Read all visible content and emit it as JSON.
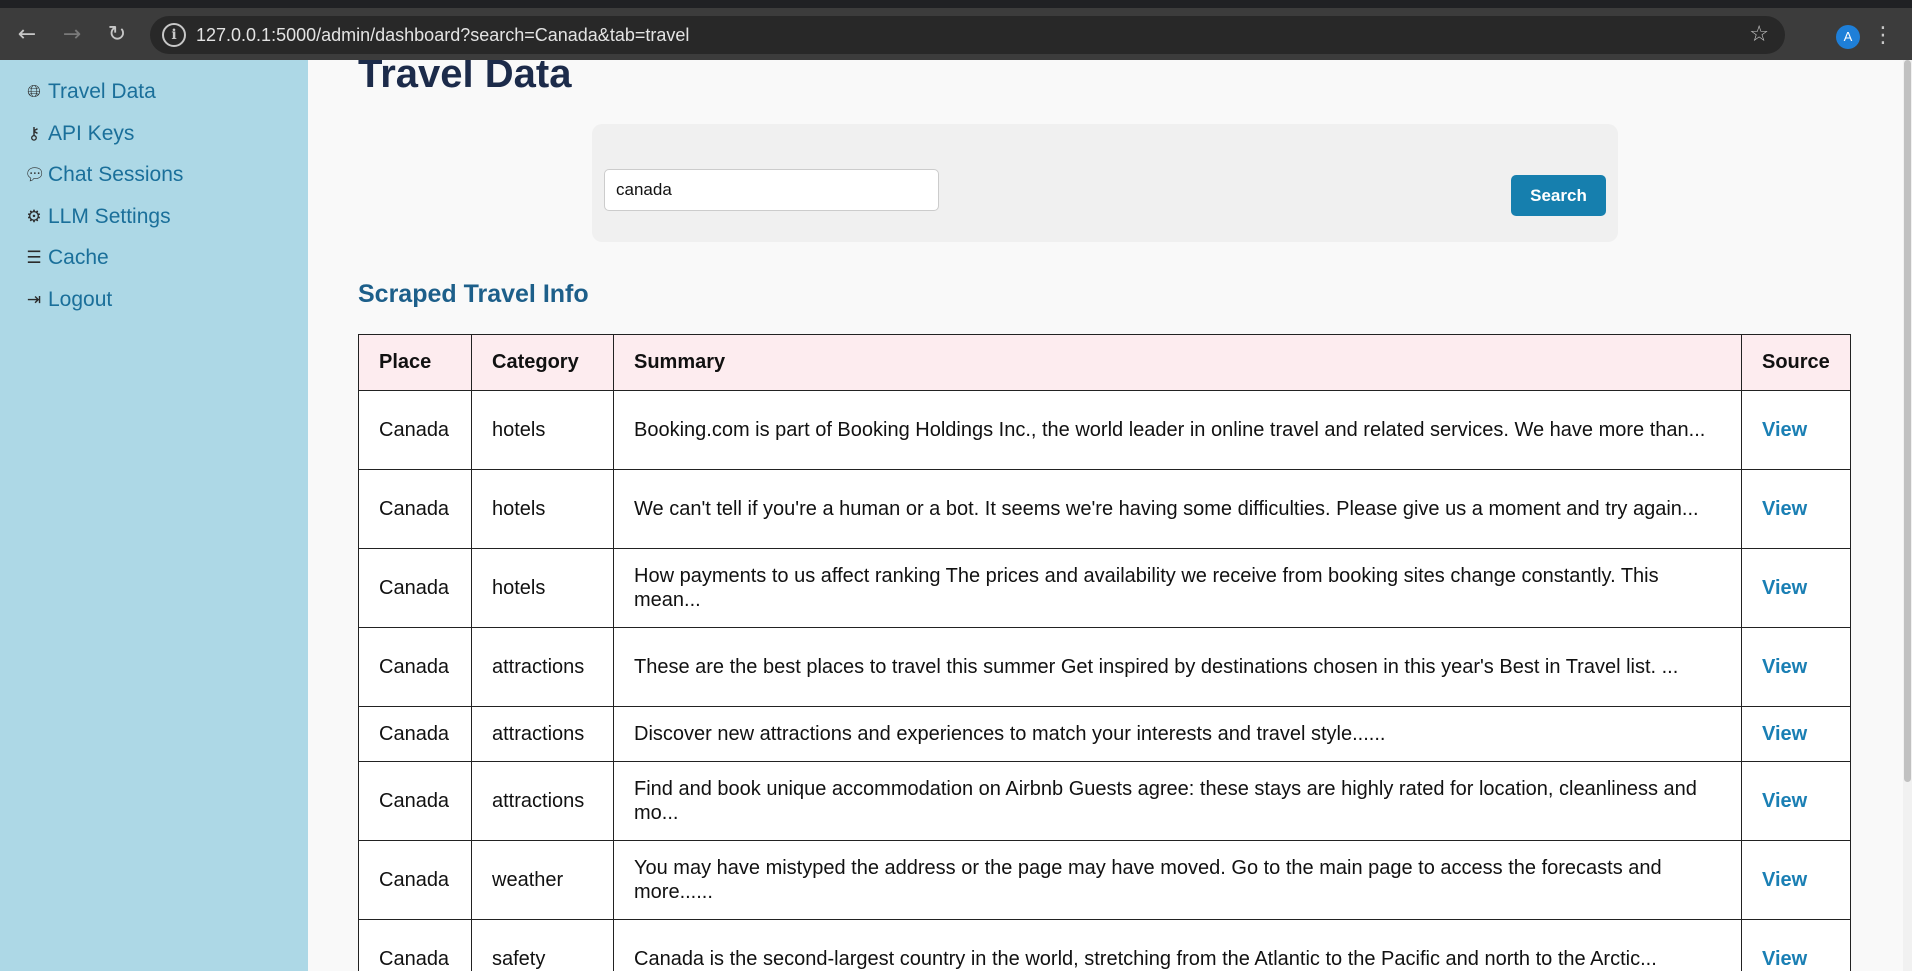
{
  "browser": {
    "url": "127.0.0.1:5000/admin/dashboard?search=Canada&tab=travel",
    "profile_initial": "A"
  },
  "sidebar": {
    "items": [
      {
        "label": "Travel Data",
        "icon": "globe-icon"
      },
      {
        "label": "API Keys",
        "icon": "key-icon"
      },
      {
        "label": "Chat Sessions",
        "icon": "comment-icon"
      },
      {
        "label": "LLM Settings",
        "icon": "gear-icon"
      },
      {
        "label": "Cache",
        "icon": "database-icon"
      },
      {
        "label": "Logout",
        "icon": "sign-out-icon"
      }
    ]
  },
  "main": {
    "title": "Travel Data",
    "search": {
      "value": "canada",
      "button_label": "Search"
    },
    "section_title": "Scraped Travel Info",
    "table": {
      "headers": [
        "Place",
        "Category",
        "Summary",
        "Source"
      ],
      "rows": [
        {
          "place": "Canada",
          "category": "hotels",
          "summary": "Booking.com is part of Booking Holdings Inc., the world leader in online travel and related services. We have more than...",
          "source": "View"
        },
        {
          "place": "Canada",
          "category": "hotels",
          "summary": "We can't tell if you're a human or a bot. It seems we're having some difficulties. Please give us a moment and try again...",
          "source": "View"
        },
        {
          "place": "Canada",
          "category": "hotels",
          "summary": "How payments to us affect ranking The prices and availability we receive from booking sites change constantly. This mean...",
          "source": "View"
        },
        {
          "place": "Canada",
          "category": "attractions",
          "summary": "These are the best places to travel this summer Get inspired by destinations chosen in this year's Best in Travel list. ...",
          "source": "View"
        },
        {
          "place": "Canada",
          "category": "attractions",
          "summary": "Discover new attractions and experiences to match your interests and travel style......",
          "source": "View"
        },
        {
          "place": "Canada",
          "category": "attractions",
          "summary": "Find and book unique accommodation on Airbnb Guests agree: these stays are highly rated for location, cleanliness and mo...",
          "source": "View"
        },
        {
          "place": "Canada",
          "category": "weather",
          "summary": "You may have mistyped the address or the page may have moved. Go to the main page to access the forecasts and more......",
          "source": "View"
        },
        {
          "place": "Canada",
          "category": "safety",
          "summary": "Canada is the second-largest country in the world, stretching from the Atlantic to the Pacific and north to the Arctic...",
          "source": "View"
        }
      ]
    }
  }
}
